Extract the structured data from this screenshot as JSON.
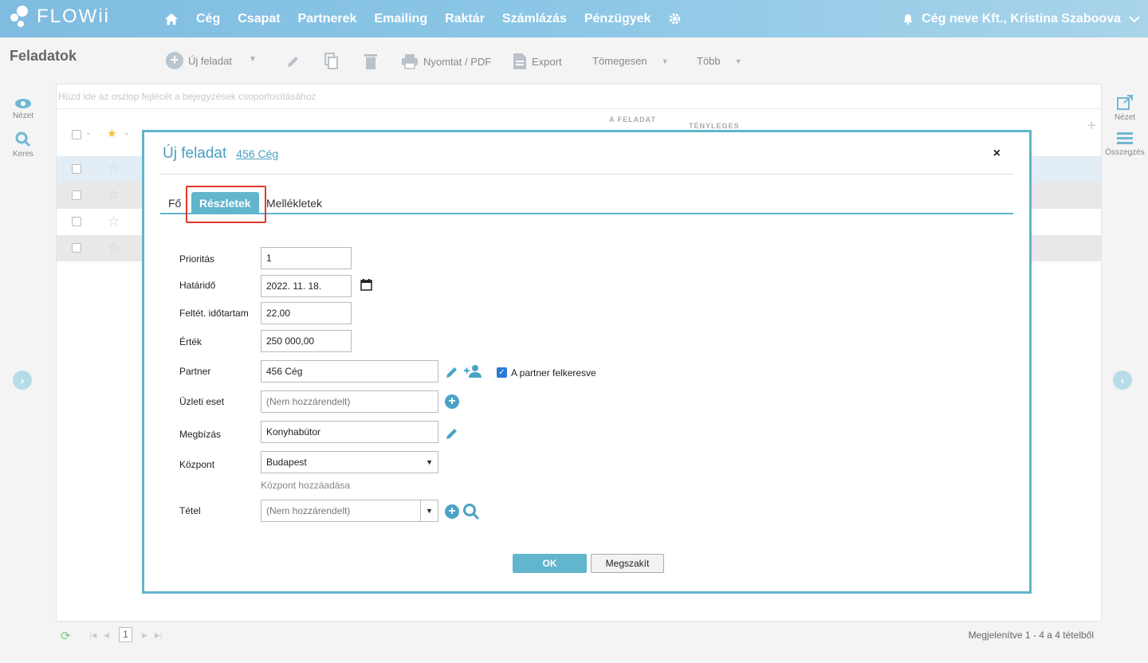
{
  "app": {
    "logo": "FLOWii"
  },
  "nav": {
    "items": [
      "Cég",
      "Csapat",
      "Partnerek",
      "Emailing",
      "Raktár",
      "Számlázás",
      "Pénzügyek"
    ]
  },
  "user": {
    "name": "Cég neve Kft., Kristina Szaboova"
  },
  "toolbar": {
    "page_title": "Feladatok",
    "new_task": "Új feladat",
    "print": "Nyomtat / PDF",
    "export": "Export",
    "bulk": "Tömegesen",
    "more": "Több"
  },
  "sidebar": {
    "view": "Nézet",
    "search": "Keres",
    "view_right": "Nézet",
    "summary": "Összegzés"
  },
  "grid": {
    "group_hint": "Húzd ide az oszlop fejlécét a bejegyzések csoportosításához",
    "col_task_start": "A FELADAT",
    "col_actual": "TÉNYLEGES"
  },
  "footer": {
    "page": "1",
    "summary": "Megjelenítve 1 - 4 a 4 tételből"
  },
  "modal": {
    "title": "Új feladat",
    "subtitle": "456 Cég",
    "close": "×",
    "tabs": [
      "Fő",
      "Részletek",
      "Mellékletek"
    ],
    "fields": {
      "priority_label": "Prioritás",
      "priority_value": "1",
      "deadline_label": "Határidő",
      "deadline_value": "2022. 11. 18.",
      "duration_label": "Feltét. időtartam",
      "duration_value": "22,00",
      "value_label": "Érték",
      "value_value": "250 000,00",
      "partner_label": "Partner",
      "partner_value": "456 Cég",
      "partner_checkbox": "A partner felkeresve",
      "deal_label": "Üzleti eset",
      "deal_placeholder": "(Nem hozzárendelt)",
      "order_label": "Megbízás",
      "order_value": "Konyhabútor",
      "center_label": "Központ",
      "center_value": "Budapest",
      "center_add": "Központ hozzáadása",
      "item_label": "Tétel",
      "item_placeholder": "(Nem hozzárendelt)"
    },
    "ok": "OK",
    "cancel": "Megszakít"
  },
  "colors": {
    "accent": "#61b5cc",
    "highlight": "#e03a28",
    "topbar": "#8cc7e6"
  }
}
